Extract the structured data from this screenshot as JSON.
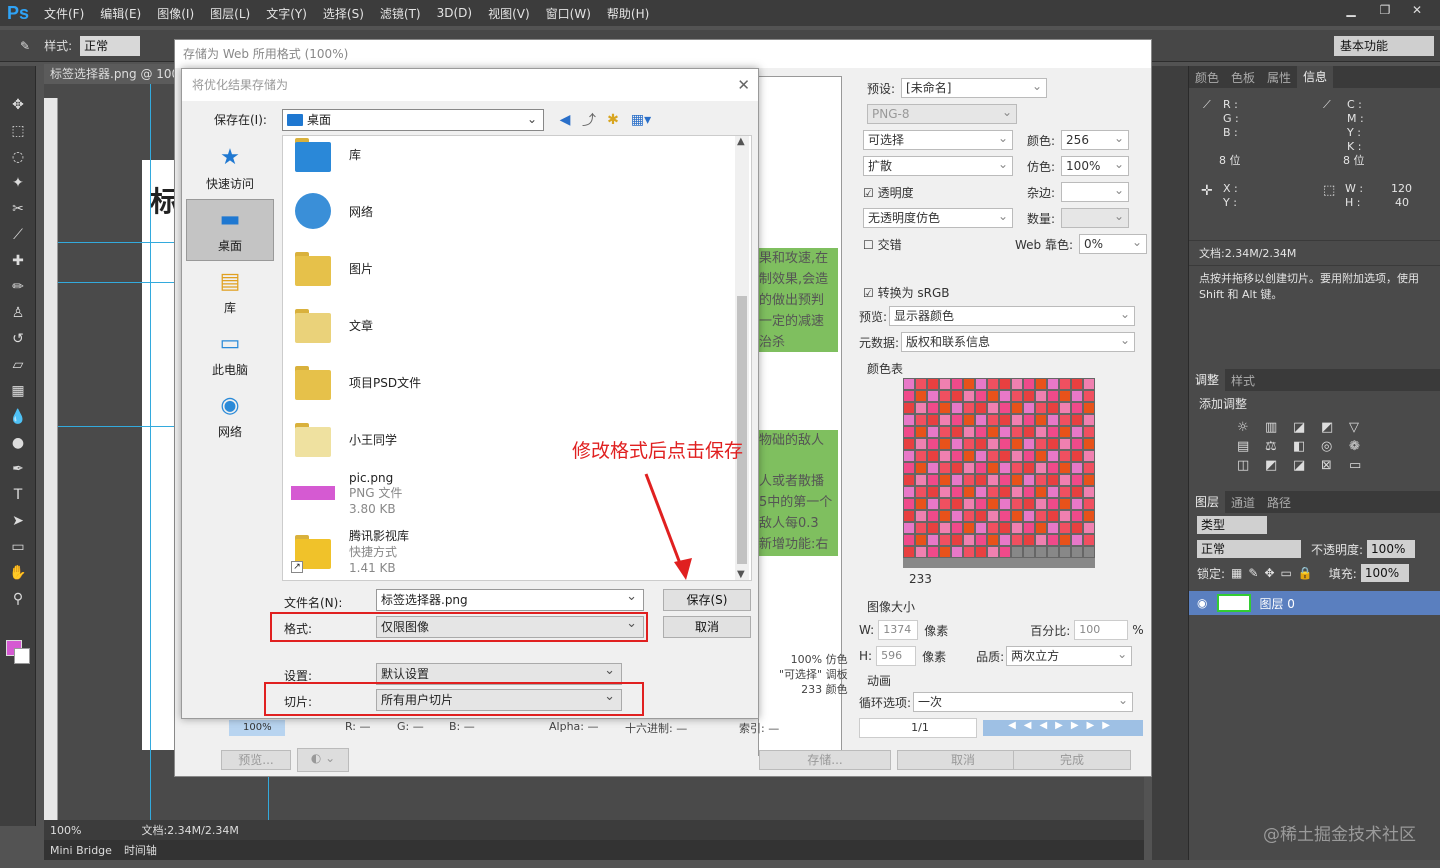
{
  "ps": {
    "logo": "Ps",
    "menus": [
      "文件(F)",
      "编辑(E)",
      "图像(I)",
      "图层(L)",
      "文字(Y)",
      "选择(S)",
      "滤镜(T)",
      "3D(D)",
      "视图(V)",
      "窗口(W)",
      "帮助(H)"
    ],
    "options": {
      "style_label": "样式:",
      "style_value": "正常"
    },
    "workspace": "基本功能",
    "doc_tab": "标签选择器.png @ 100",
    "doc_title_char": "标",
    "zoom": "100%",
    "doc_size": "文档:2.34M/2.34M",
    "bottom_tabs": [
      "Mini Bridge",
      "时间轴"
    ]
  },
  "panels": {
    "info_tabs": [
      "颜色",
      "色板",
      "属性",
      "信息"
    ],
    "info": {
      "rgb": "R :\nG :\nB :",
      "cmyk": "C :\nM :\nY :\nK :",
      "bits_left": "8 位",
      "bits_right": "8 位",
      "xy": "X :\nY :",
      "wh": "W :\nH :",
      "w_val": "120",
      "h_val": "40",
      "doc": "文档:2.34M/2.34M",
      "hint": "点按并拖移以创建切片。要用附加选项，使用 Shift 和 Alt 键。"
    },
    "adj_tabs": [
      "调整",
      "样式"
    ],
    "adj_title": "添加调整",
    "layers_tabs": [
      "图层",
      "通道",
      "路径"
    ],
    "layers": {
      "kind": "类型",
      "blend": "正常",
      "opacity_label": "不透明度:",
      "opacity": "100%",
      "lock_label": "锁定:",
      "fill_label": "填充:",
      "fill": "100%",
      "layer_name": "图层 0"
    }
  },
  "sfw": {
    "title": "存储为 Web 所用格式 (100%)",
    "preview_snippets": [
      "果和攻速,在",
      "制效果,会造",
      "的做出预判",
      "一定的减速",
      "治杀"
    ],
    "preview_snippets2": [
      "物础的敌人",
      "人或者散播",
      "5中的第一个",
      "敌人每0.3",
      "新增功能:右"
    ],
    "preset_label": "预设:",
    "preset_value": "[未命名]",
    "format": "PNG-8",
    "reduction": "可选择",
    "colors_label": "颜色:",
    "colors": "256",
    "dither_algo": "扩散",
    "dither_label": "仿色:",
    "dither": "100%",
    "transparency": "透明度",
    "matte_label": "杂边:",
    "trans_dither": "无透明度仿色",
    "amount_label": "数量:",
    "interlaced": "交错",
    "web_snap_label": "Web 靠色:",
    "web_snap": "0%",
    "convert_srgb": "转换为 sRGB",
    "preview_label": "预览:",
    "preview_value": "显示器颜色",
    "metadata_label": "元数据:",
    "metadata_value": "版权和联系信息",
    "color_table_label": "颜色表",
    "color_count": "233",
    "image_size_label": "图像大小",
    "w_label": "W:",
    "w": "1374",
    "h_label": "H:",
    "h": "596",
    "px": "像素",
    "percent_label": "百分比:",
    "percent": "100",
    "pct": "%",
    "quality_label": "品质:",
    "quality": "两次立方",
    "anim_label": "动画",
    "loop_label": "循环选项:",
    "loop": "一次",
    "frame": "1/1",
    "info_lines": [
      "100% 仿色",
      "\"可选择\" 调板",
      "233 颜色"
    ],
    "bar_zoom": "100%",
    "bar_r": "R: —",
    "bar_g": "G: —",
    "bar_b": "B: —",
    "bar_alpha": "Alpha: —",
    "bar_hex": "十六进制: —",
    "bar_index": "索引: —",
    "btn_preview": "预览...",
    "btn_save": "存储...",
    "btn_cancel": "取消",
    "btn_done": "完成"
  },
  "dialog": {
    "title": "将优化结果存储为",
    "save_in_label": "保存在(I):",
    "save_in_value": "桌面",
    "places": [
      {
        "label": "快速访问",
        "icon": "★"
      },
      {
        "label": "桌面",
        "icon": "▬"
      },
      {
        "label": "库",
        "icon": "▤"
      },
      {
        "label": "此电脑",
        "icon": "▭"
      },
      {
        "label": "网络",
        "icon": "◉"
      }
    ],
    "files": [
      {
        "name": "库",
        "meta1": "",
        "meta2": ""
      },
      {
        "name": "网络",
        "meta1": "",
        "meta2": ""
      },
      {
        "name": "图片",
        "meta1": "",
        "meta2": ""
      },
      {
        "name": "文章",
        "meta1": "",
        "meta2": ""
      },
      {
        "name": "项目PSD文件",
        "meta1": "",
        "meta2": ""
      },
      {
        "name": "小王同学",
        "meta1": "",
        "meta2": ""
      },
      {
        "name": "pic.png",
        "meta1": "PNG 文件",
        "meta2": "3.80 KB"
      },
      {
        "name": "腾讯影视库",
        "meta1": "快捷方式",
        "meta2": "1.41 KB"
      }
    ],
    "filename_label": "文件名(N):",
    "filename": "标签选择器.png",
    "format_label": "格式:",
    "format": "仅限图像",
    "settings_label": "设置:",
    "settings": "默认设置",
    "slices_label": "切片:",
    "slices": "所有用户切片",
    "save_btn": "保存(S)",
    "cancel_btn": "取消"
  },
  "annotation": "修改格式后点击保存",
  "watermark": "@稀土掘金技术社区",
  "colors": {
    "annotation_red": "#e02020",
    "ps_blue": "#2fa3f6",
    "fg_swatch": "#d55ad2"
  }
}
